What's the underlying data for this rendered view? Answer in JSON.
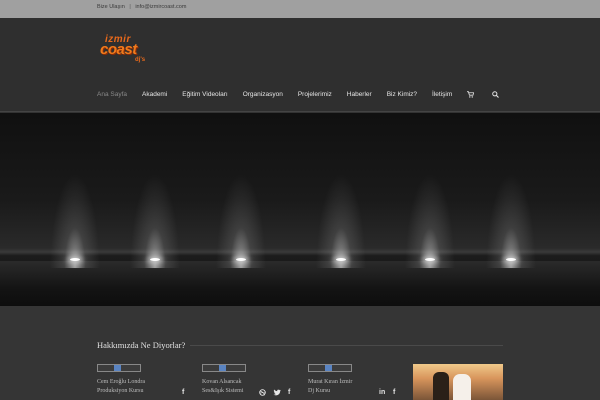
{
  "topbar": {
    "phone": "Bize Ulaşın",
    "separator": "|",
    "email": "info@izmircoast.com"
  },
  "logo": {
    "line1": "izmir",
    "line2": "coast",
    "line3": "dj's"
  },
  "nav": {
    "items": [
      "Ana Sayfa",
      "Akademi",
      "Eğitim Videoları",
      "Organizasyon",
      "Projelerimiz",
      "Haberler",
      "Biz Kimiz?",
      "İletişim"
    ],
    "cart_icon": "cart-icon",
    "search_icon": "search-icon"
  },
  "testimonials": {
    "title": "Hakkımızda Ne Diyorlar?",
    "items": [
      {
        "text_line1": "Cem Eroğlu Londra",
        "text_line2": "Produksiyon Kursu"
      },
      {
        "text_line1": "Kovan Alsancak",
        "text_line2": "Ses&Işık Sistemi"
      },
      {
        "text_line1": "Murat Kıran İzmir",
        "text_line2": "Dj Kursu"
      }
    ],
    "social": {
      "facebook": "f",
      "twitter": "t",
      "linkedin": "in"
    }
  },
  "colors": {
    "accent": "#f07a1c",
    "topbar": "#a0a0a0",
    "background": "#333333"
  }
}
